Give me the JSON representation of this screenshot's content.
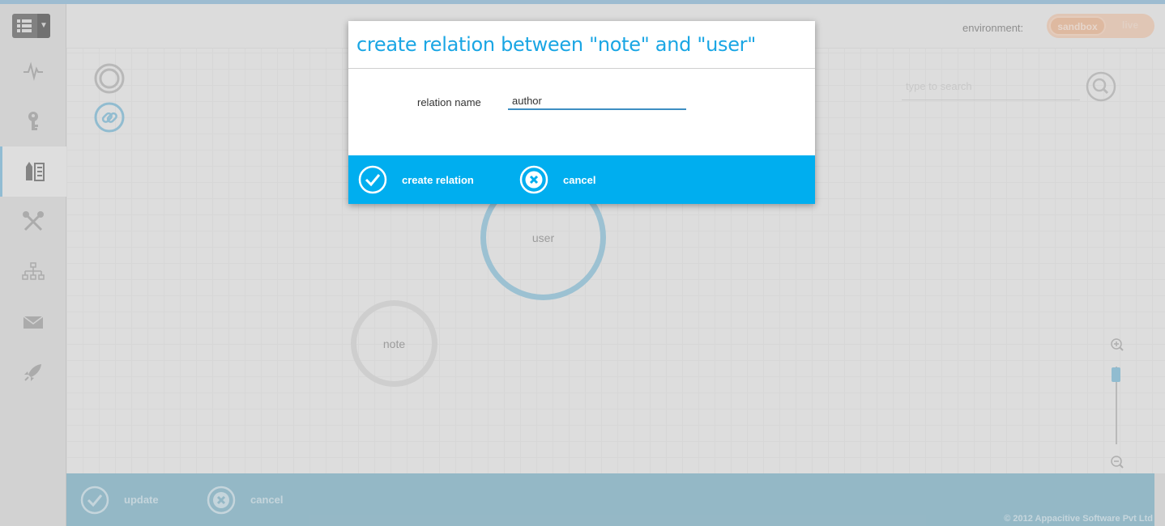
{
  "header": {
    "environment_label": "environment:",
    "environment_options": [
      "sandbox",
      "live"
    ],
    "environment_selected": "sandbox"
  },
  "sidebar": {
    "items": [
      {
        "icon": "pulse-icon"
      },
      {
        "icon": "key-icon"
      },
      {
        "icon": "schema-icon",
        "active": true
      },
      {
        "icon": "tools-icon"
      },
      {
        "icon": "hierarchy-icon"
      },
      {
        "icon": "mail-icon"
      },
      {
        "icon": "rocket-icon"
      }
    ]
  },
  "canvas": {
    "search_placeholder": "type to search",
    "nodes": [
      {
        "label": "user"
      },
      {
        "label": "note"
      }
    ]
  },
  "bottombar": {
    "update_label": "update",
    "cancel_label": "cancel",
    "copyright": "© 2012 Appacitive Software Pvt Ltd"
  },
  "modal": {
    "title": "create relation between \"note\" and \"user\"",
    "field_label": "relation name",
    "field_value": "author",
    "create_label": "create relation",
    "cancel_label": "cancel"
  },
  "colors": {
    "accent": "#00aeef",
    "title_blue": "#1aa6e4",
    "bottombar": "#a0c6d5",
    "sandbox": "#efc7ad"
  }
}
